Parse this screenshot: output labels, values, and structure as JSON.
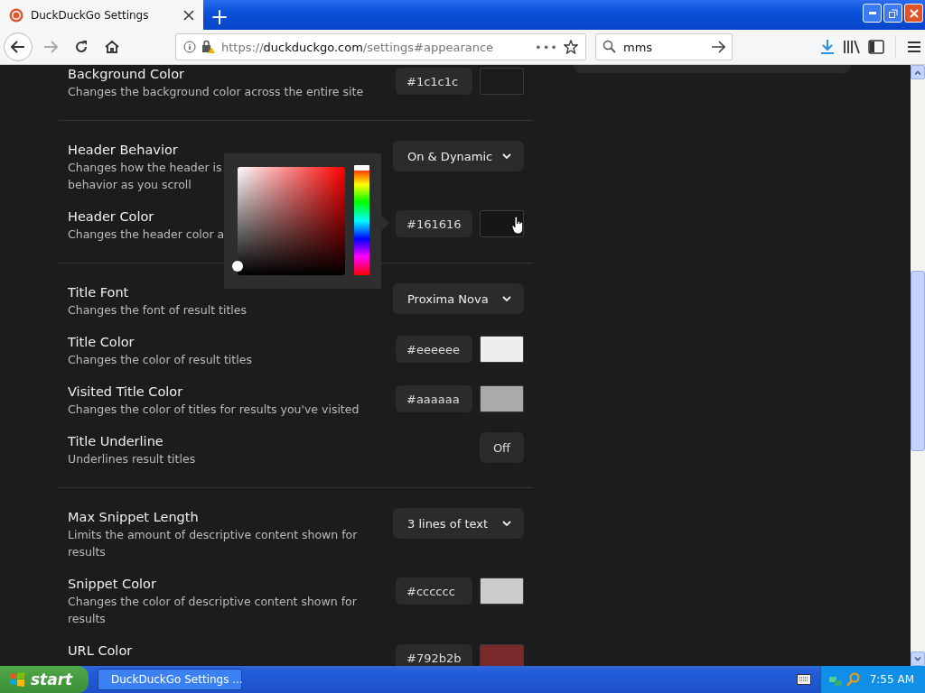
{
  "browser": {
    "tab": {
      "title": "DuckDuckGo Settings",
      "selected": true
    },
    "new_tab": "+",
    "nav": {
      "forward_enabled": false
    },
    "address": {
      "scheme": "https://",
      "host": "duckduckgo.com",
      "path": "/settings#appearance",
      "more": "•••"
    },
    "search": {
      "value": "mms"
    }
  },
  "settings": {
    "sections": [
      {
        "rows": [
          {
            "kind": "color",
            "title": "Background Color",
            "description": [
              "Changes the background color across the entire site"
            ],
            "value": "#1c1c1c",
            "color": "#1c1c1c"
          }
        ]
      },
      {
        "rows": [
          {
            "kind": "select",
            "title": "Header Behavior",
            "description": [
              "Changes how the header is",
              "behavior as you scroll"
            ],
            "value": "On & Dynamic"
          },
          {
            "kind": "color",
            "title": "Header Color",
            "description": [
              "Changes the header color a"
            ],
            "value": "#161616",
            "color": "#161616",
            "hovered": true
          }
        ]
      },
      {
        "rows": [
          {
            "kind": "select",
            "title": "Title Font",
            "description": [
              "Changes the font of result titles"
            ],
            "value": "Proxima Nova"
          },
          {
            "kind": "color",
            "title": "Title Color",
            "description": [
              "Changes the color of result titles"
            ],
            "value": "#eeeeee",
            "color": "#eeeeee"
          },
          {
            "kind": "color",
            "title": "Visited Title Color",
            "description": [
              "Changes the color of titles for results you've visited"
            ],
            "value": "#aaaaaa",
            "color": "#aaaaaa"
          },
          {
            "kind": "toggle",
            "title": "Title Underline",
            "description": [
              "Underlines result titles"
            ],
            "value": "Off",
            "on": false
          }
        ]
      },
      {
        "rows": [
          {
            "kind": "select",
            "title": "Max Snippet Length",
            "description": [
              "Limits the amount of descriptive content shown for",
              "results"
            ],
            "value": "3 lines of text"
          },
          {
            "kind": "color",
            "title": "Snippet Color",
            "description": [
              "Changes the color of descriptive content shown for",
              "results"
            ],
            "value": "#cccccc",
            "color": "#cccccc"
          },
          {
            "kind": "color",
            "title": "URL Color",
            "description": [],
            "value": "#792b2b",
            "color": "#792b2b"
          }
        ]
      }
    ]
  },
  "color_picker": {
    "open": true
  },
  "taskbar": {
    "start": "start",
    "tasks": [
      {
        "label": "DuckDuckGo Settings ..."
      }
    ],
    "clock": "7:55 AM"
  }
}
